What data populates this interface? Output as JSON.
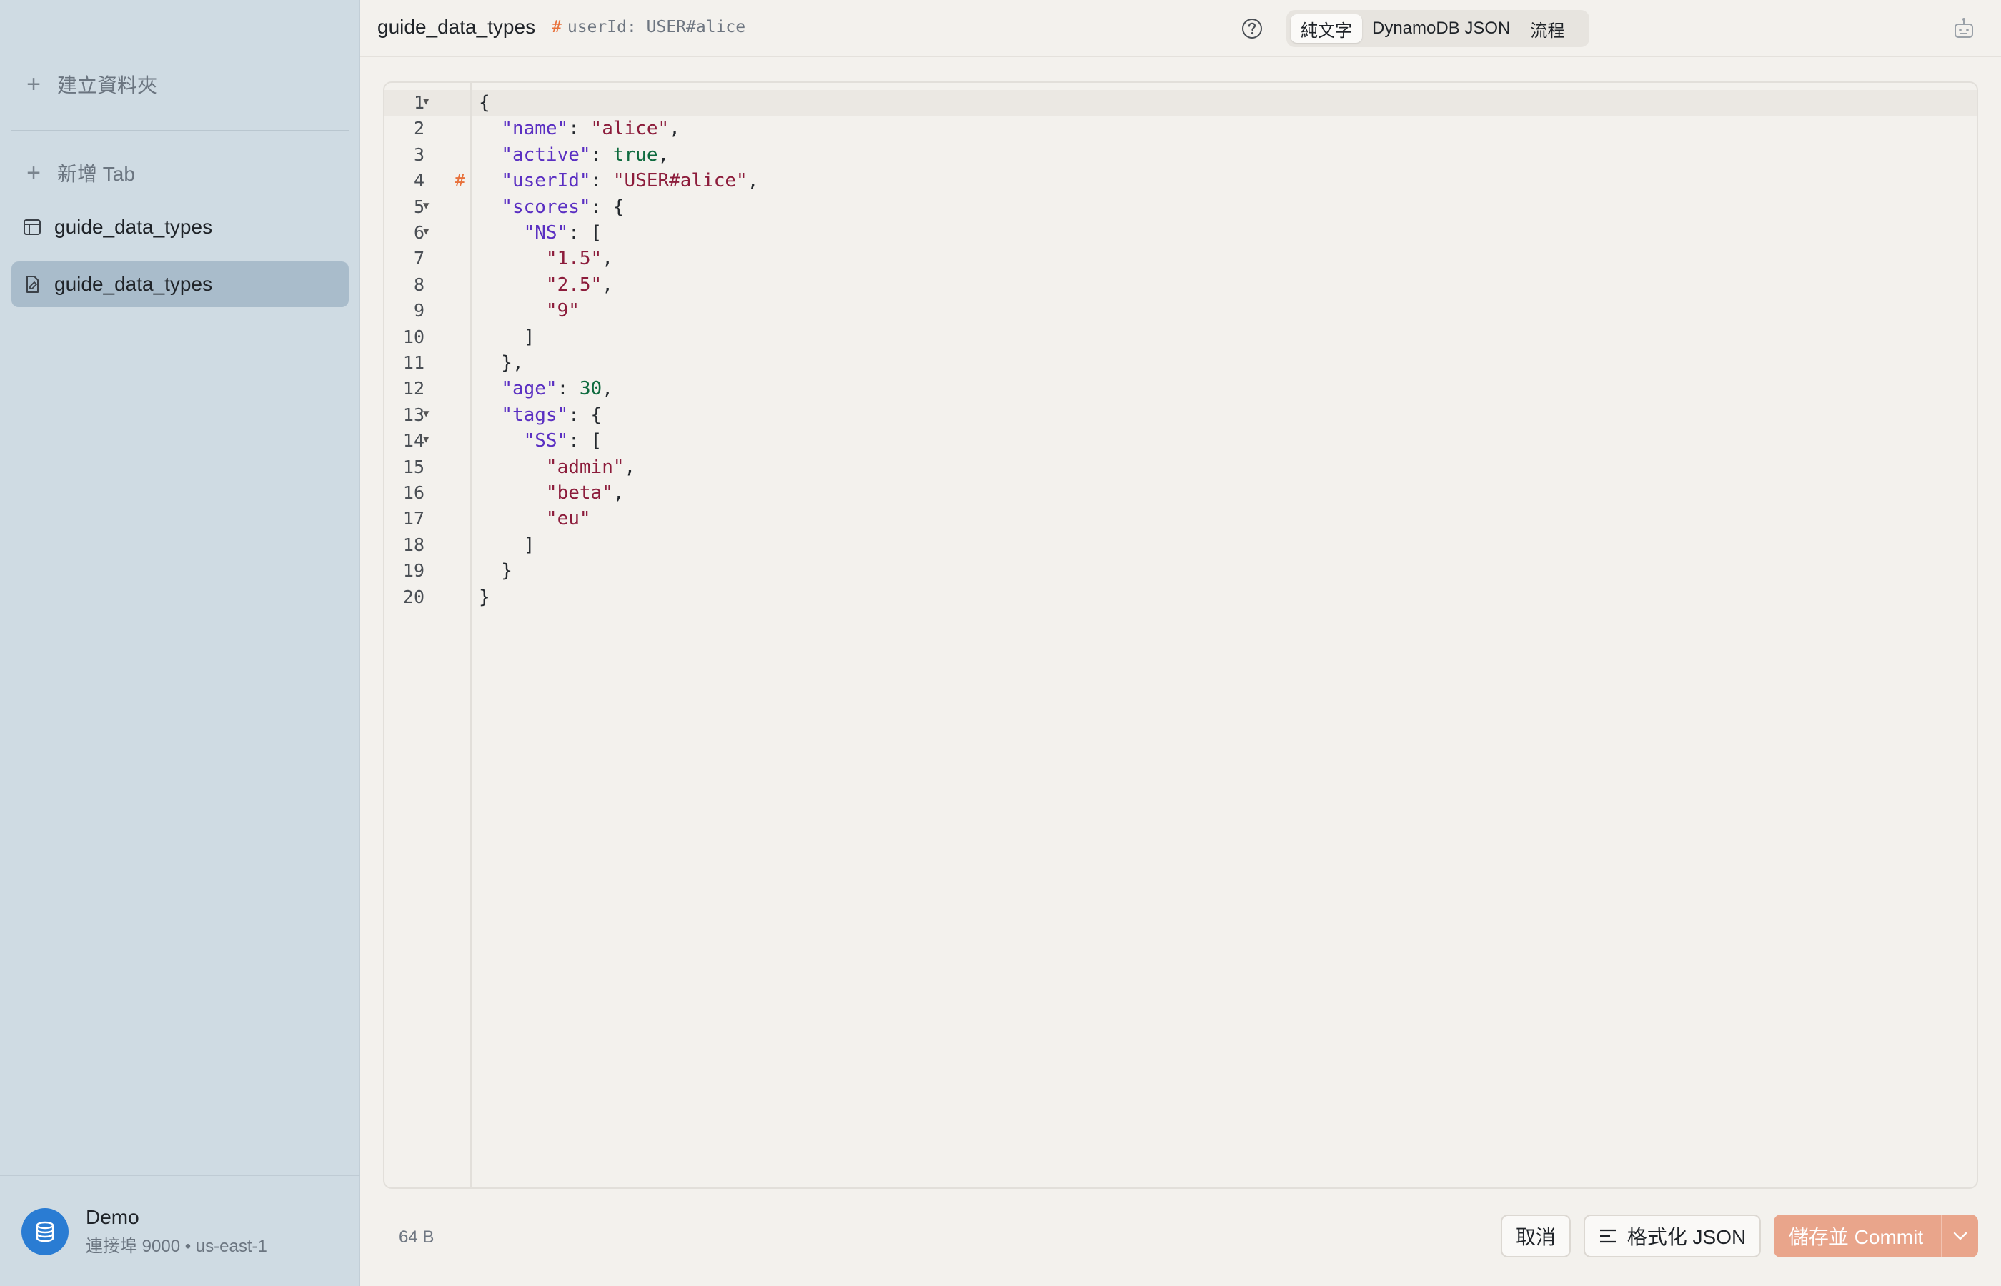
{
  "sidebar": {
    "create_folder": "建立資料夾",
    "new_tab": "新增 Tab",
    "items": [
      {
        "label": "guide_data_types",
        "icon": "table-icon"
      },
      {
        "label": "guide_data_types",
        "icon": "document-edit-icon",
        "active": true
      }
    ],
    "account": {
      "name": "Demo",
      "detail": "連接埠 9000 • us-east-1",
      "icon": "database-icon"
    }
  },
  "header": {
    "title": "guide_data_types",
    "key_hash": "#",
    "key_text": "userId: USER#alice",
    "modes": [
      "純文字",
      "DynamoDB JSON",
      "流程"
    ],
    "selected_mode": "純文字"
  },
  "editor": {
    "lines": [
      {
        "n": "1",
        "fold": true,
        "mark": "",
        "tokens": [
          [
            "p",
            "{"
          ]
        ]
      },
      {
        "n": "2",
        "fold": false,
        "mark": "",
        "tokens": [
          [
            "p",
            "  "
          ],
          [
            "k",
            "\"name\""
          ],
          [
            "p",
            ": "
          ],
          [
            "s",
            "\"alice\""
          ],
          [
            "p",
            ","
          ]
        ]
      },
      {
        "n": "3",
        "fold": false,
        "mark": "",
        "tokens": [
          [
            "p",
            "  "
          ],
          [
            "k",
            "\"active\""
          ],
          [
            "p",
            ": "
          ],
          [
            "b",
            "true"
          ],
          [
            "p",
            ","
          ]
        ]
      },
      {
        "n": "4",
        "fold": false,
        "mark": "#",
        "tokens": [
          [
            "p",
            "  "
          ],
          [
            "k",
            "\"userId\""
          ],
          [
            "p",
            ": "
          ],
          [
            "s",
            "\"USER#alice\""
          ],
          [
            "p",
            ","
          ]
        ]
      },
      {
        "n": "5",
        "fold": true,
        "mark": "",
        "tokens": [
          [
            "p",
            "  "
          ],
          [
            "k",
            "\"scores\""
          ],
          [
            "p",
            ": {"
          ]
        ]
      },
      {
        "n": "6",
        "fold": true,
        "mark": "",
        "tokens": [
          [
            "p",
            "    "
          ],
          [
            "k",
            "\"NS\""
          ],
          [
            "p",
            ": ["
          ]
        ]
      },
      {
        "n": "7",
        "fold": false,
        "mark": "",
        "tokens": [
          [
            "p",
            "      "
          ],
          [
            "s",
            "\"1.5\""
          ],
          [
            "p",
            ","
          ]
        ]
      },
      {
        "n": "8",
        "fold": false,
        "mark": "",
        "tokens": [
          [
            "p",
            "      "
          ],
          [
            "s",
            "\"2.5\""
          ],
          [
            "p",
            ","
          ]
        ]
      },
      {
        "n": "9",
        "fold": false,
        "mark": "",
        "tokens": [
          [
            "p",
            "      "
          ],
          [
            "s",
            "\"9\""
          ]
        ]
      },
      {
        "n": "10",
        "fold": false,
        "mark": "",
        "tokens": [
          [
            "p",
            "    ]"
          ]
        ]
      },
      {
        "n": "11",
        "fold": false,
        "mark": "",
        "tokens": [
          [
            "p",
            "  },"
          ]
        ]
      },
      {
        "n": "12",
        "fold": false,
        "mark": "",
        "tokens": [
          [
            "p",
            "  "
          ],
          [
            "k",
            "\"age\""
          ],
          [
            "p",
            ": "
          ],
          [
            "n",
            "30"
          ],
          [
            "p",
            ","
          ]
        ]
      },
      {
        "n": "13",
        "fold": true,
        "mark": "",
        "tokens": [
          [
            "p",
            "  "
          ],
          [
            "k",
            "\"tags\""
          ],
          [
            "p",
            ": {"
          ]
        ]
      },
      {
        "n": "14",
        "fold": true,
        "mark": "",
        "tokens": [
          [
            "p",
            "    "
          ],
          [
            "k",
            "\"SS\""
          ],
          [
            "p",
            ": ["
          ]
        ]
      },
      {
        "n": "15",
        "fold": false,
        "mark": "",
        "tokens": [
          [
            "p",
            "      "
          ],
          [
            "s",
            "\"admin\""
          ],
          [
            "p",
            ","
          ]
        ]
      },
      {
        "n": "16",
        "fold": false,
        "mark": "",
        "tokens": [
          [
            "p",
            "      "
          ],
          [
            "s",
            "\"beta\""
          ],
          [
            "p",
            ","
          ]
        ]
      },
      {
        "n": "17",
        "fold": false,
        "mark": "",
        "tokens": [
          [
            "p",
            "      "
          ],
          [
            "s",
            "\"eu\""
          ]
        ]
      },
      {
        "n": "18",
        "fold": false,
        "mark": "",
        "tokens": [
          [
            "p",
            "    ]"
          ]
        ]
      },
      {
        "n": "19",
        "fold": false,
        "mark": "",
        "tokens": [
          [
            "p",
            "  }"
          ]
        ]
      },
      {
        "n": "20",
        "fold": false,
        "mark": "",
        "tokens": [
          [
            "p",
            "}"
          ]
        ]
      }
    ]
  },
  "footer": {
    "size": "64 B",
    "cancel": "取消",
    "format": "格式化 JSON",
    "commit": "儲存並 Commit"
  },
  "colors": {
    "accent_hash": "#e8713b",
    "commit_button": "#e9a58b",
    "sidebar_bg": "#cfdbe3",
    "sidebar_active": "#a9bccb",
    "avatar": "#2a7cd3"
  }
}
